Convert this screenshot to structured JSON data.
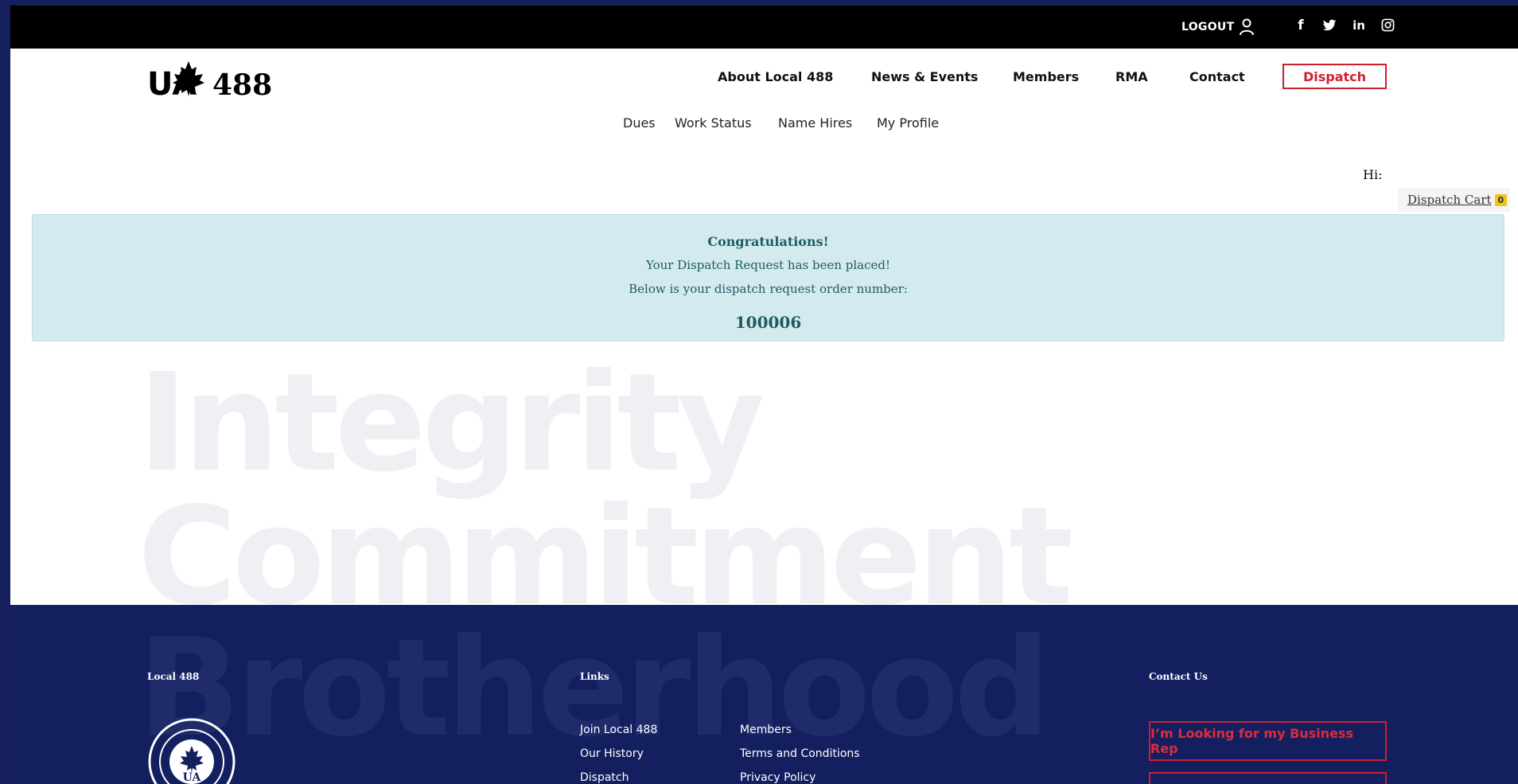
{
  "topbar": {
    "logout_label": "LOGOUT",
    "social": [
      {
        "name": "facebook-icon",
        "glyph": "f"
      },
      {
        "name": "twitter-icon",
        "glyph": "t"
      },
      {
        "name": "linkedin-icon",
        "glyph": "in"
      },
      {
        "name": "instagram-icon",
        "glyph": "◎"
      }
    ]
  },
  "logo": {
    "mark": "UA",
    "number": "488"
  },
  "nav": {
    "items": [
      "About Local 488",
      "News & Events",
      "Members",
      "RMA",
      "Contact"
    ],
    "dispatch_label": "Dispatch"
  },
  "subnav": {
    "items": [
      "Dues",
      "Work Status",
      "Name Hires",
      "My Profile"
    ]
  },
  "user": {
    "greeting": "Hi:"
  },
  "cart": {
    "label": "Dispatch Cart",
    "count": "0"
  },
  "alert": {
    "title": "Congratulations!",
    "line1": "Your Dispatch Request has been placed!",
    "line2": "Below is your dispatch request order number:",
    "order_number": "100006"
  },
  "hero": {
    "words": [
      "Integrity",
      "Commitment",
      "Brotherhood"
    ]
  },
  "footer": {
    "col1_heading": "Local 488",
    "col2_heading": "Links",
    "col3_heading": "Contact Us",
    "links_a": [
      "Join Local 488",
      "Our History",
      "Dispatch"
    ],
    "links_b": [
      "Members",
      "Terms and Conditions",
      "Privacy Policy"
    ],
    "business_rep_label": "I’m Looking for my Business Rep"
  },
  "colors": {
    "navy": "#131f5f",
    "accent_red": "#cf1f2f",
    "alert_bg": "#d3ebef",
    "badge": "#f0c419"
  }
}
